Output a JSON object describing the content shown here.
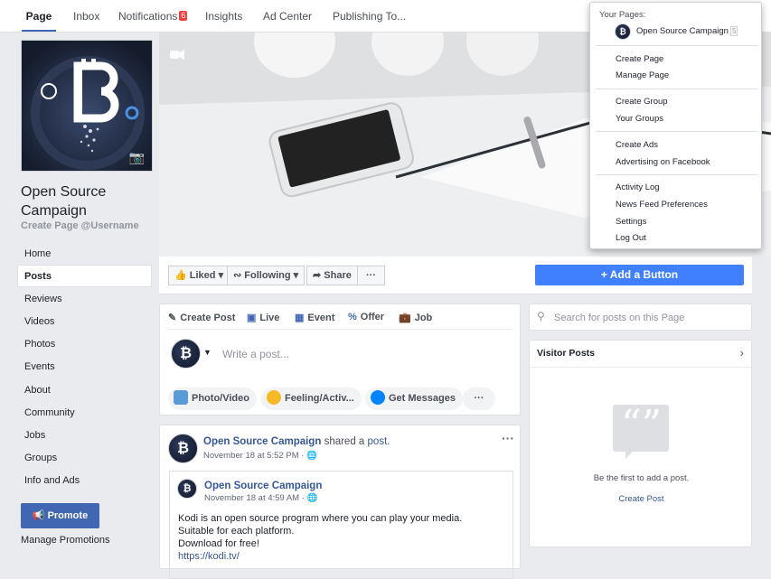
{
  "topnav": {
    "tabs": [
      "Page",
      "Inbox",
      "Notifications",
      "Insights",
      "Ad Center",
      "Publishing To..."
    ],
    "notifications_count": "6"
  },
  "page": {
    "name": "Open Source Campaign",
    "username_prompt": "Create Page @Username"
  },
  "sidebar": {
    "items": [
      "Home",
      "Posts",
      "Reviews",
      "Videos",
      "Photos",
      "Events",
      "About",
      "Community",
      "Jobs",
      "Groups",
      "Info and Ads"
    ],
    "active": "Posts",
    "promote_label": "Promote",
    "manage_promotions": "Manage Promotions"
  },
  "actionbar": {
    "liked": "Liked",
    "following": "Following",
    "share": "Share",
    "more": "···",
    "add_button": "Add a Button"
  },
  "composer": {
    "tabs": [
      "Create Post",
      "Live",
      "Event",
      "Offer",
      "Job"
    ],
    "placeholder": "Write a post...",
    "chips": [
      "Photo/Video",
      "Feeling/Activ...",
      "Get Messages"
    ],
    "more": "···"
  },
  "post": {
    "author": "Open Source Campaign",
    "action_text": "shared a",
    "action_link": "post.",
    "time": "November 18 at 5:52 PM",
    "more": "···",
    "shared": {
      "author": "Open Source Campaign",
      "time": "November 18 at 4:59 AM",
      "lines": [
        "Kodi is an open source program where you can play your media.",
        "Suitable for each platform.",
        "Download for free!"
      ],
      "url": "https://kodi.tv/"
    }
  },
  "right": {
    "search_placeholder": "Search for posts on this Page",
    "visitor_title": "Visitor Posts",
    "empty_text": "Be the first to add a post.",
    "create_post": "Create Post"
  },
  "dropdown": {
    "your_pages_label": "Your Pages:",
    "page_name": "Open Source Campaign",
    "page_count": "5",
    "group1": [
      "Create Page",
      "Manage Page"
    ],
    "group2": [
      "Create Group",
      "Your Groups"
    ],
    "group3": [
      "Create Ads",
      "Advertising on Facebook"
    ],
    "group4": [
      "Activity Log",
      "News Feed Preferences",
      "Settings",
      "Log Out"
    ]
  },
  "colors": {
    "brand": "#4267b2",
    "button_blue": "#4080ff",
    "badge_red": "#fa3e3e"
  }
}
